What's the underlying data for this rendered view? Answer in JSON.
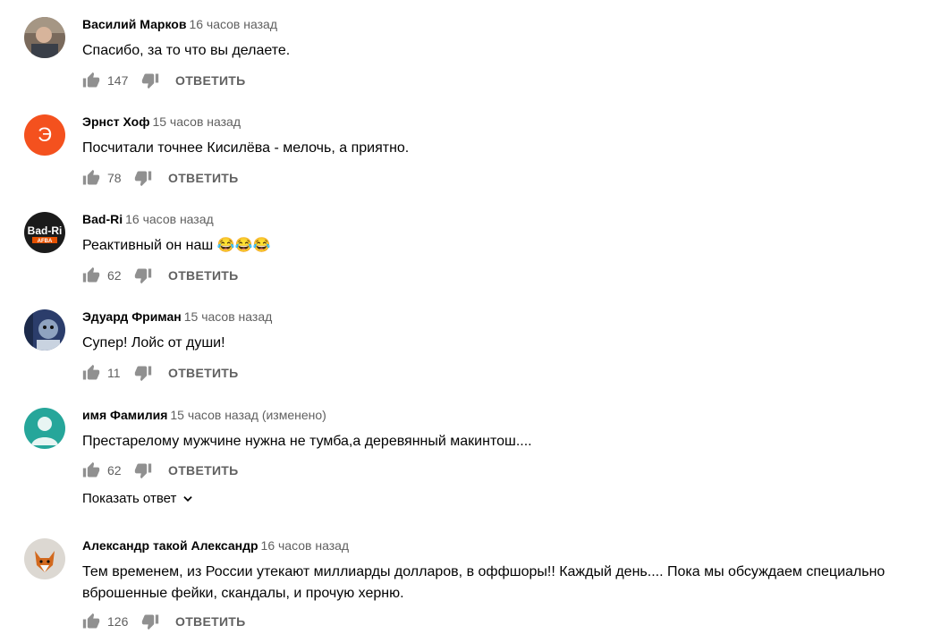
{
  "comments": [
    {
      "author": "Василий Марков",
      "time": "16 часов назад",
      "text": "Спасибо, за то что вы делаете.",
      "likes": "147",
      "reply": "ОТВЕТИТЬ"
    },
    {
      "author": "Эрнст Хоф",
      "time": "15 часов назад",
      "text": "Посчитали точнее Кисилёва -  мелочь, а приятно.",
      "likes": "78",
      "reply": "ОТВЕТИТЬ",
      "avatar_letter": "Э"
    },
    {
      "author": "Bad-Ri",
      "time": "16 часов назад",
      "text": "Реактивный он наш 😂😂😂",
      "likes": "62",
      "reply": "ОТВЕТИТЬ",
      "avatar_text": "Bad-Ri",
      "avatar_subtext": "AFBA"
    },
    {
      "author": "Эдуард Фриман",
      "time": "15 часов назад",
      "text": "Супер! Лойс от души!",
      "likes": "11",
      "reply": "ОТВЕТИТЬ"
    },
    {
      "author": "имя Фамилия",
      "time": "15 часов назад (изменено)",
      "text": "Престарелому мужчине нужна не тумба,а деревянный макинтош....",
      "likes": "62",
      "reply": "ОТВЕТИТЬ",
      "show_replies": "Показать ответ"
    },
    {
      "author": "Александр такой Александр",
      "time": "16 часов назад",
      "text": "Тем временем, из России утекают миллиарды долларов, в оффшоры!! Каждый день.... Пока мы обсуждаем специально вброшенные фейки, скандалы, и прочую херню.",
      "likes": "126",
      "reply": "ОТВЕТИТЬ"
    }
  ],
  "colors": {
    "accent_avatar_orange": "#f4511e",
    "avatar_teal": "#26a69a",
    "secondary_text": "#606060"
  }
}
